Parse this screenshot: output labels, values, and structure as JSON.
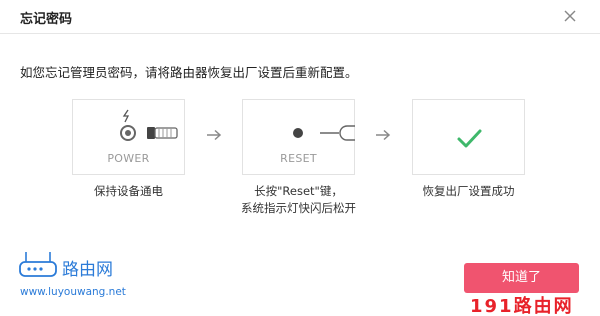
{
  "dialog": {
    "title": "忘记密码",
    "description": "如您忘记管理员密码，请将路由器恢复出厂设置后重新配置。",
    "confirm_label": "知道了"
  },
  "steps": [
    {
      "icon_label": "POWER",
      "caption_lines": [
        "保持设备通电"
      ]
    },
    {
      "icon_label": "RESET",
      "caption_lines": [
        "长按\"Reset\"键，",
        "系统指示灯快闪后松开"
      ]
    },
    {
      "icon_label": "",
      "caption_lines": [
        "恢复出厂设置成功"
      ]
    }
  ],
  "watermark": {
    "logo_text": "路由网",
    "url": "www.luyouwang.net",
    "badge": "191路由网"
  },
  "colors": {
    "accent": "#f0546f",
    "check": "#3fb86b",
    "logo_blue": "#2b7bd8",
    "badge_red": "#e8222a"
  }
}
